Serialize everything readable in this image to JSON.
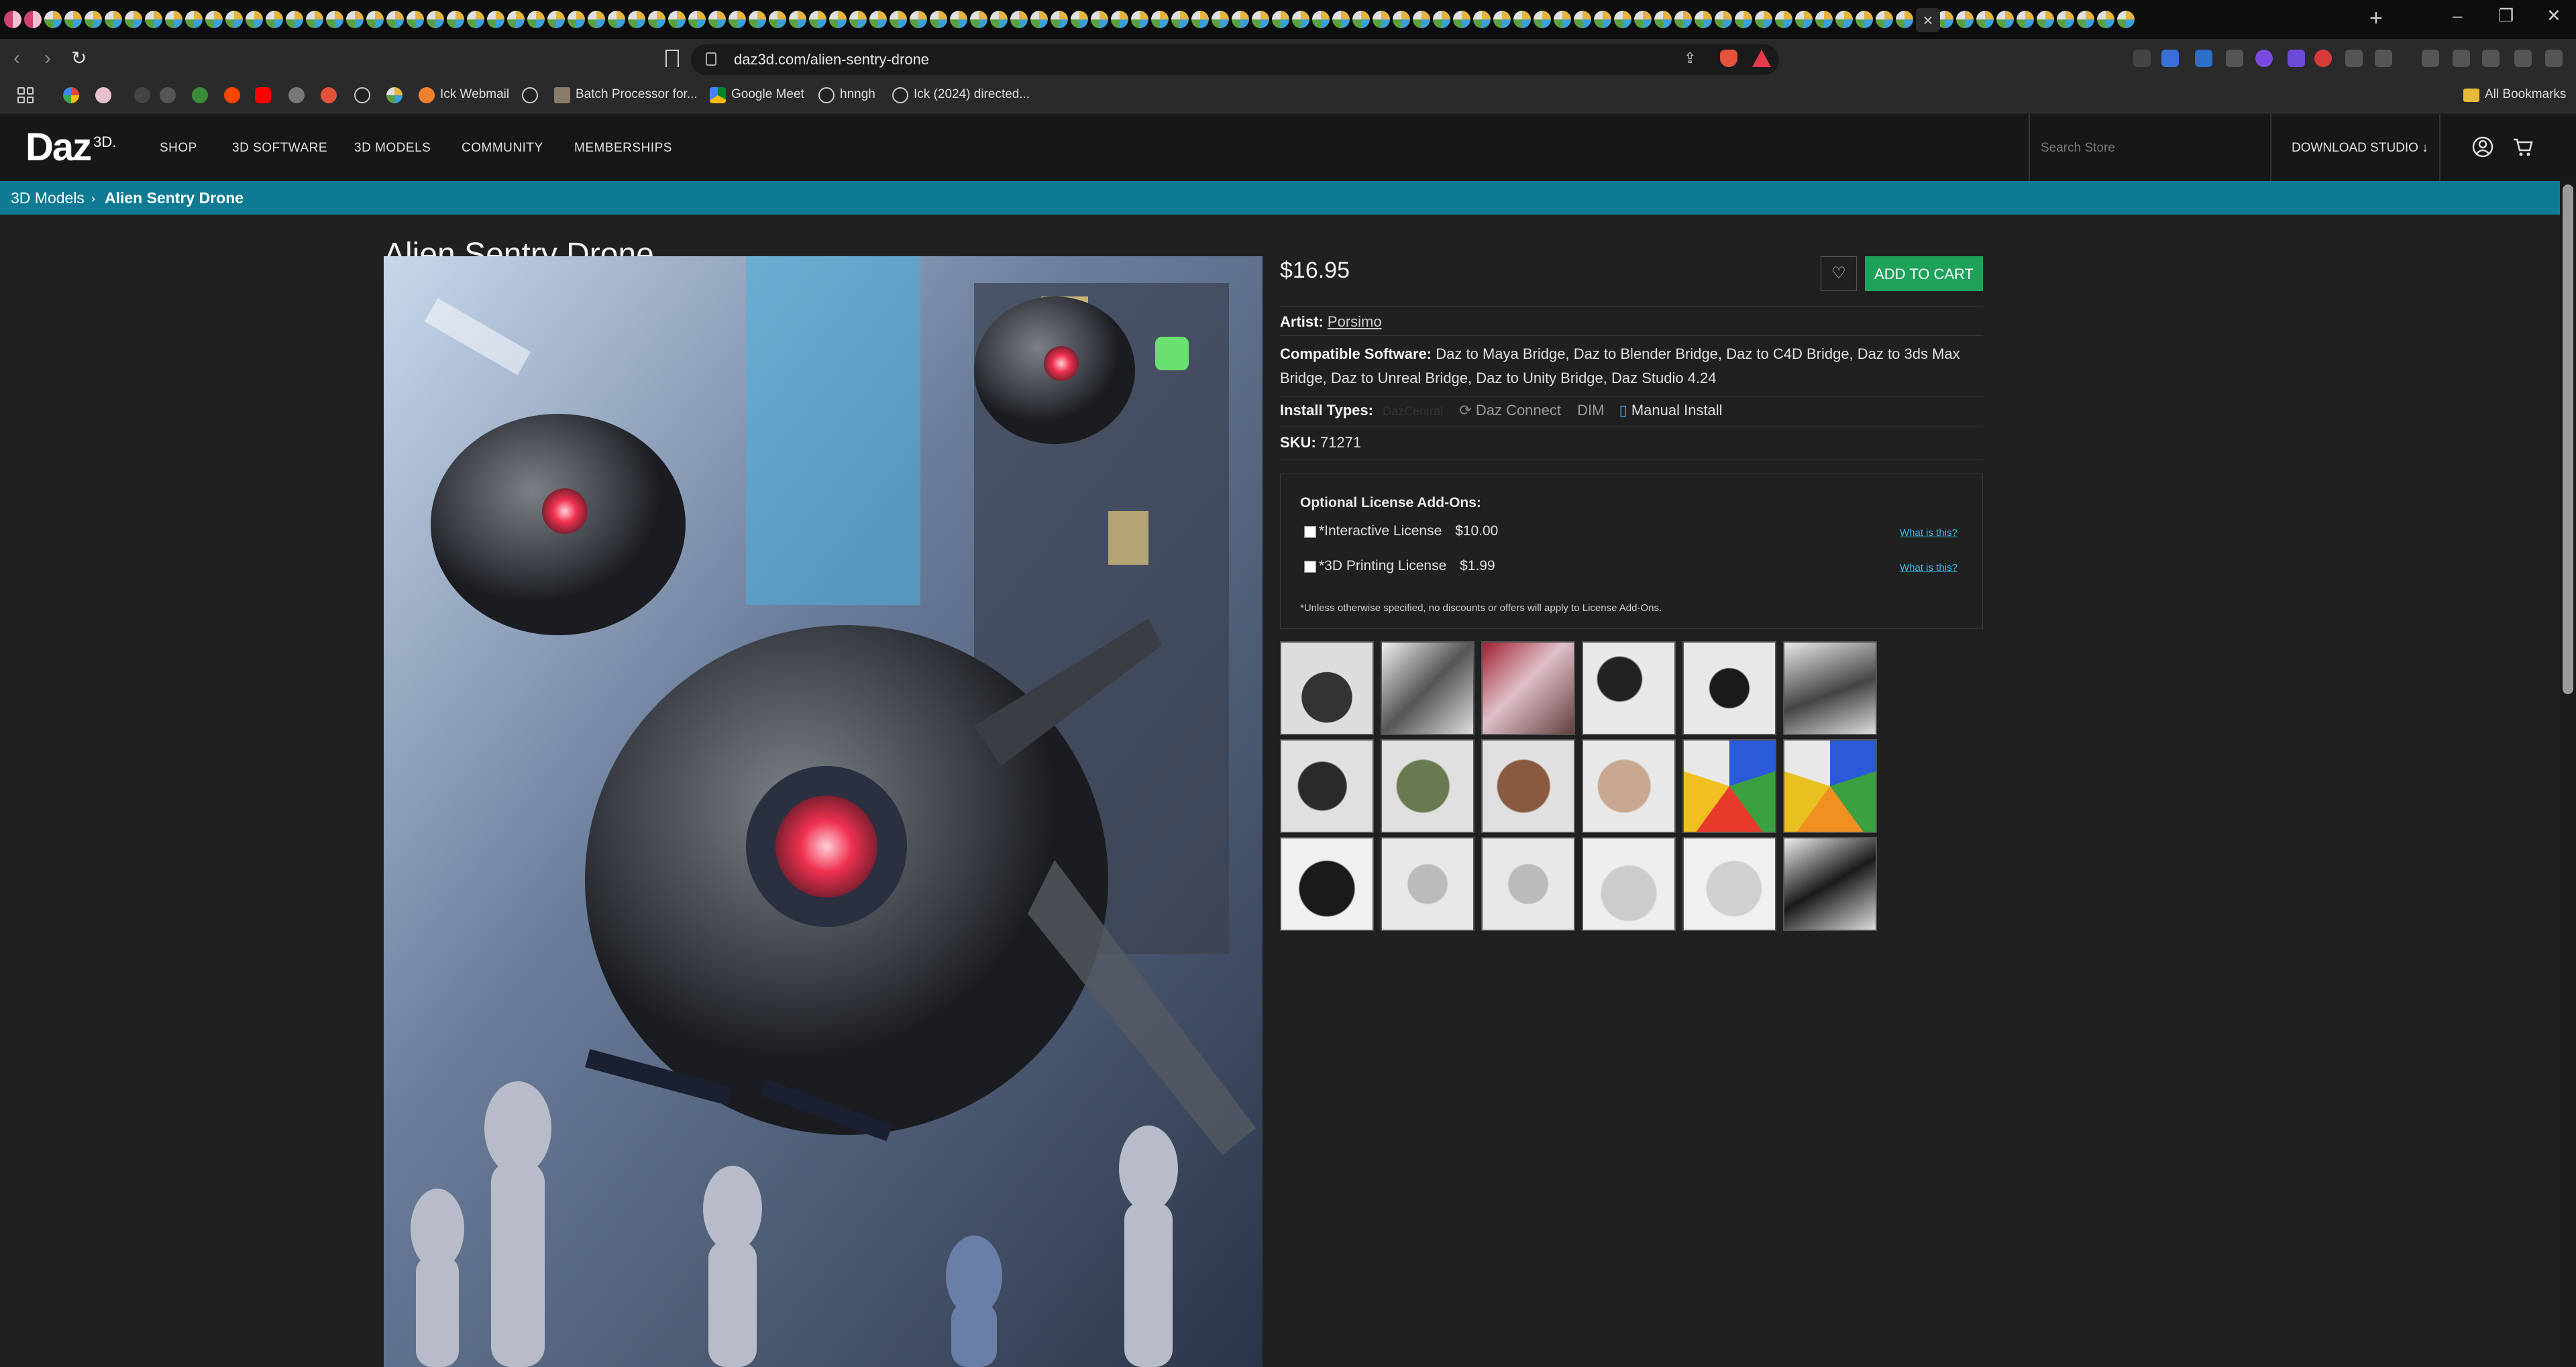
{
  "browser": {
    "url": "daz3d.com/alien-sentry-drone",
    "bookmarks": [
      "Ick Webmail",
      "Batch Processor for...",
      "Google Meet",
      "hnngh",
      "Ick (2024) directed...",
      "All Bookmarks"
    ]
  },
  "header": {
    "logo_text": "Daz",
    "logo_sup": "3D.",
    "nav": [
      "SHOP",
      "3D SOFTWARE",
      "3D MODELS",
      "COMMUNITY",
      "MEMBERSHIPS"
    ],
    "search_placeholder": "Search Store",
    "download_studio": "DOWNLOAD STUDIO ↓"
  },
  "breadcrumb": {
    "parent": "3D Models",
    "separator": "›",
    "current": "Alien Sentry Drone"
  },
  "product": {
    "title": "Alien Sentry Drone",
    "price": "$16.95",
    "add_to_cart": "ADD TO CART",
    "artist_label": "Artist:",
    "artist": "Porsimo",
    "compat_label": "Compatible Software:",
    "compat_line1": "Daz to Maya Bridge, Daz to Blender Bridge, Daz to C4D Bridge, Daz to 3ds Max",
    "compat_line2": "Bridge, Daz to Unreal Bridge, Daz to Unity Bridge, Daz Studio 4.24",
    "install_label": "Install Types:",
    "install_central": "DazCentral",
    "install_connect": "Daz Connect",
    "install_dim": "DIM",
    "install_manual": "Manual Install",
    "sku_label": "SKU:",
    "sku": "71271"
  },
  "addons": {
    "title": "Optional License Add-Ons:",
    "items": [
      {
        "label": "*Interactive License",
        "price": "$10.00",
        "help": "What is this?"
      },
      {
        "label": "*3D Printing License",
        "price": "$1.99",
        "help": "What is this?"
      }
    ],
    "note": "*Unless otherwise specified, no discounts or offers will apply to License Add-Ons."
  },
  "colors": {
    "accent_teal": "#0e7a94",
    "cart_green": "#1ea25a",
    "link_blue": "#3bb7e6"
  }
}
